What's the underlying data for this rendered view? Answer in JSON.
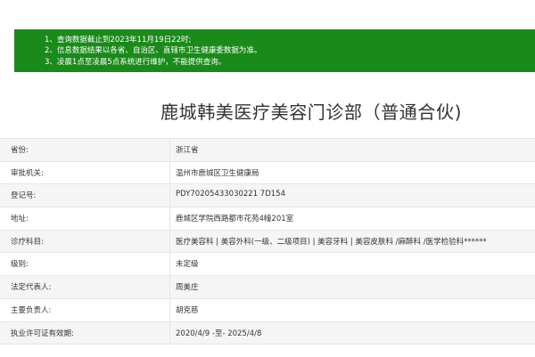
{
  "notice": {
    "lines": [
      "1、查询数据截止到2023年11月19日22时;",
      "2、信息数据结果以各省、自治区、直辖市卫生健康委数据为准。",
      "3、凌晨1点至凌晨5点系统进行维护，不能提供查询。"
    ],
    "background_color": "#1a8a1a"
  },
  "title": "鹿城韩美医疗美容门诊部（普通合伙)",
  "rows": [
    {
      "label": "省份:",
      "value": "浙江省"
    },
    {
      "label": "审批机关:",
      "value": "温州市鹿城区卫生健康局"
    },
    {
      "label": "登记号:",
      "value": "PDY70205433030221 7D154"
    },
    {
      "label": "地址:",
      "value": "鹿城区学院西路都市花苑4幢201室"
    },
    {
      "label": "诊疗科目:",
      "value": "医疗美容科 | 美容外科(一级、二级项目) | 美容牙科 | 美容皮肤科 /麻醉科 /医学检验科******"
    },
    {
      "label": "级别:",
      "value": "未定级"
    },
    {
      "label": "法定代表人:",
      "value": "周美庄"
    },
    {
      "label": "主要负责人:",
      "value": "胡克慈"
    },
    {
      "label": "执业许可证有效期:",
      "value": "2020/4/9 -至- 2025/4/8"
    }
  ]
}
